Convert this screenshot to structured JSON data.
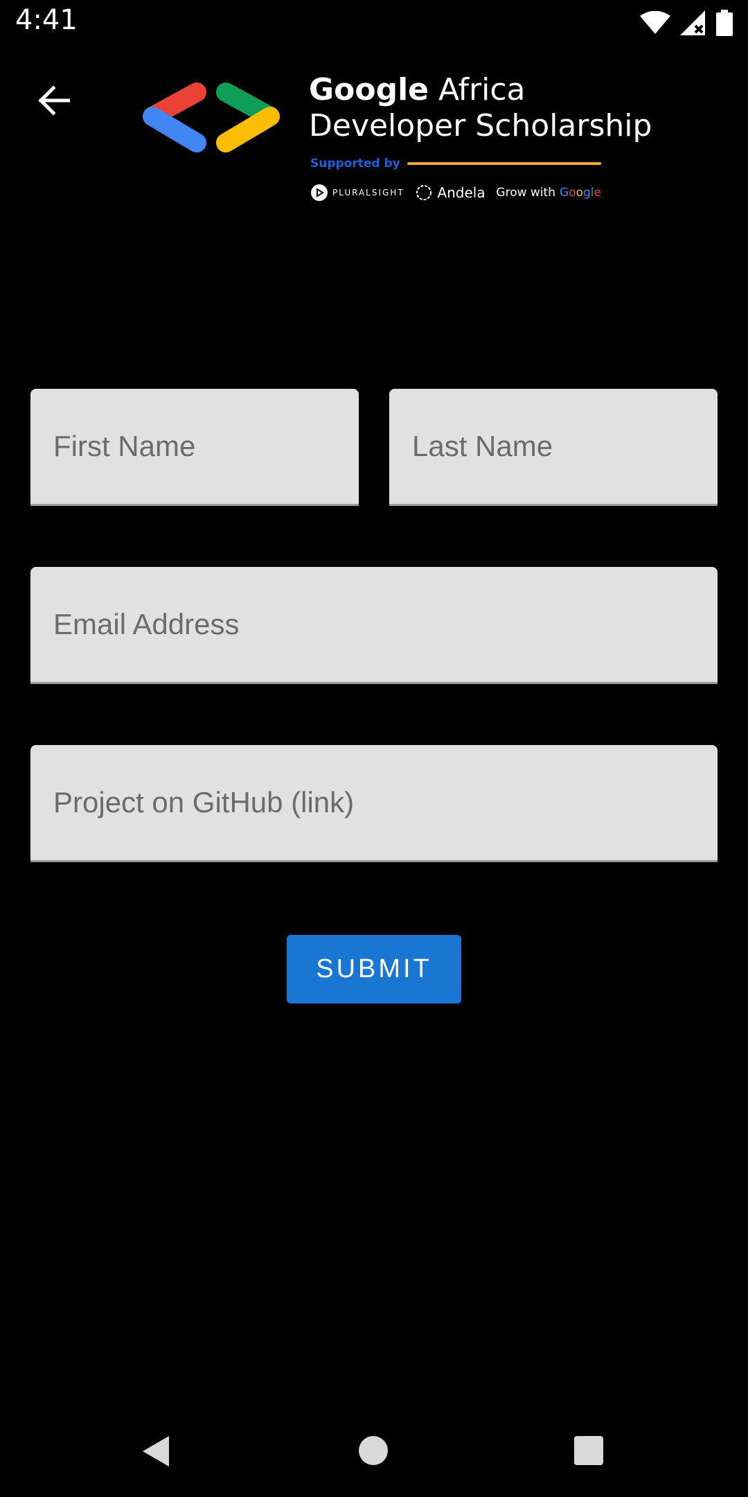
{
  "status_bar": {
    "time": "4:41",
    "icons": [
      "wifi-icon",
      "signal-icon",
      "battery-icon"
    ]
  },
  "toolbar": {
    "back_icon": "arrow-back-icon"
  },
  "header": {
    "brand": "Google",
    "title_line1_rest": "Africa",
    "title_line2": "Developer Scholarship",
    "supported_by": "Supported by",
    "partners": {
      "pluralsight": "PLURALSIGHT",
      "andela": "Andela",
      "grow_prefix": "Grow with",
      "grow_google": [
        "G",
        "o",
        "o",
        "g",
        "l",
        "e"
      ]
    }
  },
  "form": {
    "first_name_placeholder": "First Name",
    "last_name_placeholder": "Last Name",
    "email_placeholder": "Email Address",
    "project_placeholder": "Project on GitHub (link)",
    "submit_label": "SUBMIT"
  },
  "colors": {
    "background": "#000000",
    "field_background": "#e1e1e1",
    "submit_button": "#1976d2",
    "supported_by_label": "#1f5fd6",
    "supported_by_line": "#f3a83a",
    "logo_red": "#ea4335",
    "logo_blue": "#4285f4",
    "logo_green": "#0f9d58",
    "logo_yellow": "#fbbc05"
  },
  "nav_bar": {
    "icons": [
      "nav-back-icon",
      "nav-home-icon",
      "nav-recents-icon"
    ]
  }
}
